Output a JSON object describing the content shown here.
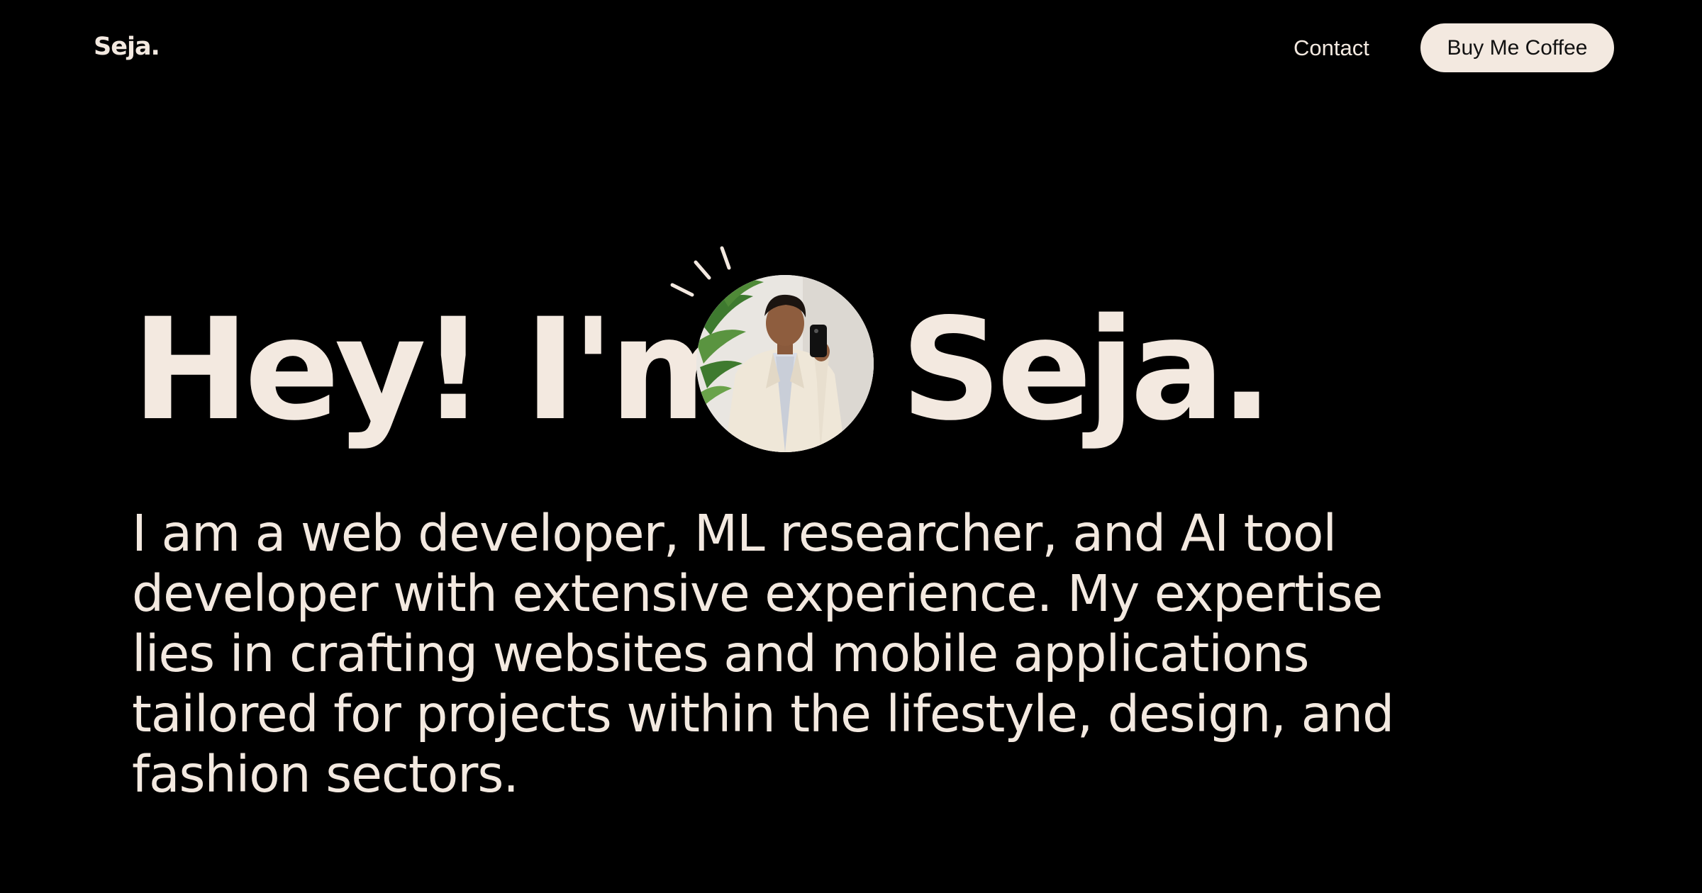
{
  "nav": {
    "logo": "Seja.",
    "contact_label": "Contact",
    "cta_label": "Buy Me Coffee"
  },
  "hero": {
    "greeting": "Hey! I'm",
    "name": "Seja.",
    "portrait_alt": "portrait photo"
  },
  "bio": {
    "lines": [
      "I am a web developer, ML researcher, and AI tool",
      "developer with extensive experience. My expertise",
      "lies in crafting websites and mobile applications",
      "tailored for projects within the lifestyle, design, and",
      "fashion sectors."
    ]
  },
  "colors": {
    "background": "#000000",
    "text": "#f3e9e0",
    "button_bg": "#f3e9e0",
    "button_text": "#111111"
  },
  "icons": {
    "sparkle": "sparkle-lines-icon"
  }
}
